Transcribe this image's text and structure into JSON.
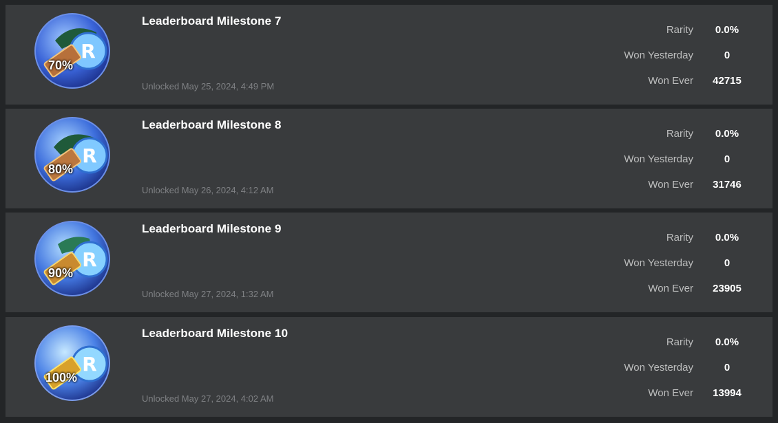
{
  "labels": {
    "rarity": "Rarity",
    "won_yesterday": "Won Yesterday",
    "won_ever": "Won Ever"
  },
  "colors": {
    "background": "#232527",
    "card": "#393b3d",
    "title": "#ffffff",
    "muted": "#7f8184"
  },
  "badges": [
    {
      "title": "Leaderboard Milestone 7",
      "unlocked": "Unlocked May 25, 2024, 4:49 PM",
      "percent": "70%",
      "icon": "milestone-badge-icon",
      "rarity": "0.0%",
      "won_yesterday": "0",
      "won_ever": "42715"
    },
    {
      "title": "Leaderboard Milestone 8",
      "unlocked": "Unlocked May 26, 2024, 4:12 AM",
      "percent": "80%",
      "icon": "milestone-badge-icon",
      "rarity": "0.0%",
      "won_yesterday": "0",
      "won_ever": "31746"
    },
    {
      "title": "Leaderboard Milestone 9",
      "unlocked": "Unlocked May 27, 2024, 1:32 AM",
      "percent": "90%",
      "icon": "milestone-badge-icon",
      "rarity": "0.0%",
      "won_yesterday": "0",
      "won_ever": "23905"
    },
    {
      "title": "Leaderboard Milestone 10",
      "unlocked": "Unlocked May 27, 2024, 4:02 AM",
      "percent": "100%",
      "icon": "milestone-badge-icon",
      "rarity": "0.0%",
      "won_yesterday": "0",
      "won_ever": "13994"
    }
  ]
}
